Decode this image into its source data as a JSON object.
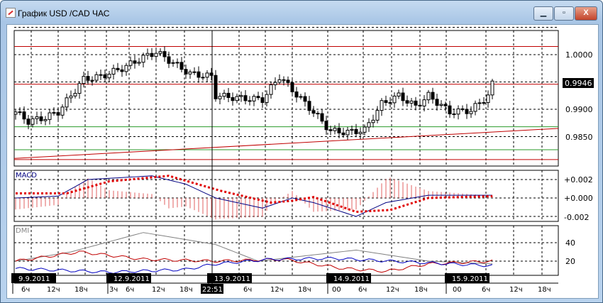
{
  "window": {
    "title": "График USD /CAD  ЧАС",
    "minimize": "▁",
    "maximize": "▫",
    "close": "X"
  },
  "axis": {
    "price_labels": [
      "1.0000",
      "0.9900",
      "0.9850"
    ],
    "current_price": "0.9946",
    "macd_labels": [
      "+0.002",
      "+0.000",
      "-0.002"
    ],
    "dmi_labels": [
      "40",
      "20"
    ],
    "macd_title": "MACD",
    "dmi_title": "DMI",
    "dates": [
      "9.9.2011",
      "12.9.2011",
      "13.9.2011",
      "14.9.2011",
      "15.9.2011"
    ],
    "hours": [
      "6ч",
      "12ч",
      "18ч",
      "3ч",
      "6ч",
      "12ч",
      "18ч",
      "6ч",
      "12ч",
      "18ч",
      "00",
      "6ч",
      "12ч",
      "18ч",
      "00",
      "6ч",
      "12ч",
      "18ч"
    ],
    "cursor_time": "22:51"
  },
  "colors": {
    "up": "#ffffff",
    "down": "#000000",
    "resistance": "#c00000",
    "trend": "#c00000",
    "support_green": "#2a9a2a",
    "macd": "#000080",
    "signal": "#e00000",
    "adx": "#808080",
    "plus_di": "#c00000",
    "minus_di": "#0000c0"
  },
  "chart_data": {
    "type": "candlestick",
    "title": "USD/CAD H1",
    "ylim": [
      0.981,
      1.0045
    ],
    "close_anchors": [
      [
        0,
        0.9895
      ],
      [
        3,
        0.9878
      ],
      [
        7,
        0.9885
      ],
      [
        10,
        0.9895
      ],
      [
        13,
        0.9925
      ],
      [
        16,
        0.9955
      ],
      [
        20,
        0.996
      ],
      [
        25,
        0.9975
      ],
      [
        30,
        0.9995
      ],
      [
        33,
        1.0005
      ],
      [
        37,
        0.9985
      ],
      [
        41,
        0.9965
      ],
      [
        46,
        0.996
      ],
      [
        47,
        0.9925
      ],
      [
        53,
        0.992
      ],
      [
        58,
        0.9918
      ],
      [
        62,
        0.996
      ],
      [
        65,
        0.9935
      ],
      [
        70,
        0.9895
      ],
      [
        74,
        0.986
      ],
      [
        78,
        0.9858
      ],
      [
        82,
        0.9862
      ],
      [
        86,
        0.991
      ],
      [
        90,
        0.9925
      ],
      [
        94,
        0.9905
      ],
      [
        97,
        0.9925
      ],
      [
        102,
        0.9895
      ],
      [
        107,
        0.9898
      ],
      [
        111,
        0.9925
      ],
      [
        112,
        0.9946
      ]
    ],
    "horizontal_lines": {
      "red": [
        1.0015,
        0.9946,
        0.9808
      ],
      "green": [
        0.9868,
        0.9826
      ]
    },
    "trendline": [
      0.981,
      0.9865
    ],
    "macd": {
      "line": [
        [
          0,
          0
        ],
        [
          10,
          0.0002
        ],
        [
          17,
          0.002
        ],
        [
          32,
          0.0024
        ],
        [
          40,
          0.0015
        ],
        [
          47,
          0
        ],
        [
          58,
          -0.0011
        ],
        [
          65,
          0
        ],
        [
          70,
          -0.0005
        ],
        [
          80,
          -0.002
        ],
        [
          87,
          -0.0005
        ],
        [
          97,
          0.0003
        ],
        [
          112,
          0.0003
        ]
      ],
      "signal": [
        [
          0,
          0.0005
        ],
        [
          12,
          0.0005
        ],
        [
          22,
          0.0018
        ],
        [
          36,
          0.0024
        ],
        [
          48,
          0.0008
        ],
        [
          60,
          -0.0005
        ],
        [
          65,
          -0.0003
        ],
        [
          70,
          0.0001
        ],
        [
          80,
          -0.0015
        ],
        [
          88,
          -0.0013
        ],
        [
          97,
          0
        ],
        [
          112,
          0.0002
        ]
      ]
    },
    "dmi": {
      "adx": [
        [
          0,
          20
        ],
        [
          13,
          30
        ],
        [
          30,
          51
        ],
        [
          47,
          38
        ],
        [
          57,
          20
        ],
        [
          80,
          32
        ],
        [
          97,
          20
        ],
        [
          112,
          17
        ]
      ],
      "plus_di": [
        [
          0,
          20
        ],
        [
          15,
          30
        ],
        [
          30,
          22
        ],
        [
          47,
          20
        ],
        [
          63,
          22
        ],
        [
          77,
          12
        ],
        [
          87,
          9
        ],
        [
          97,
          17
        ],
        [
          112,
          20
        ]
      ],
      "minus_di": [
        [
          0,
          12
        ],
        [
          22,
          8
        ],
        [
          40,
          11
        ],
        [
          47,
          17
        ],
        [
          60,
          22
        ],
        [
          75,
          23
        ],
        [
          88,
          20
        ],
        [
          112,
          15
        ]
      ]
    }
  }
}
